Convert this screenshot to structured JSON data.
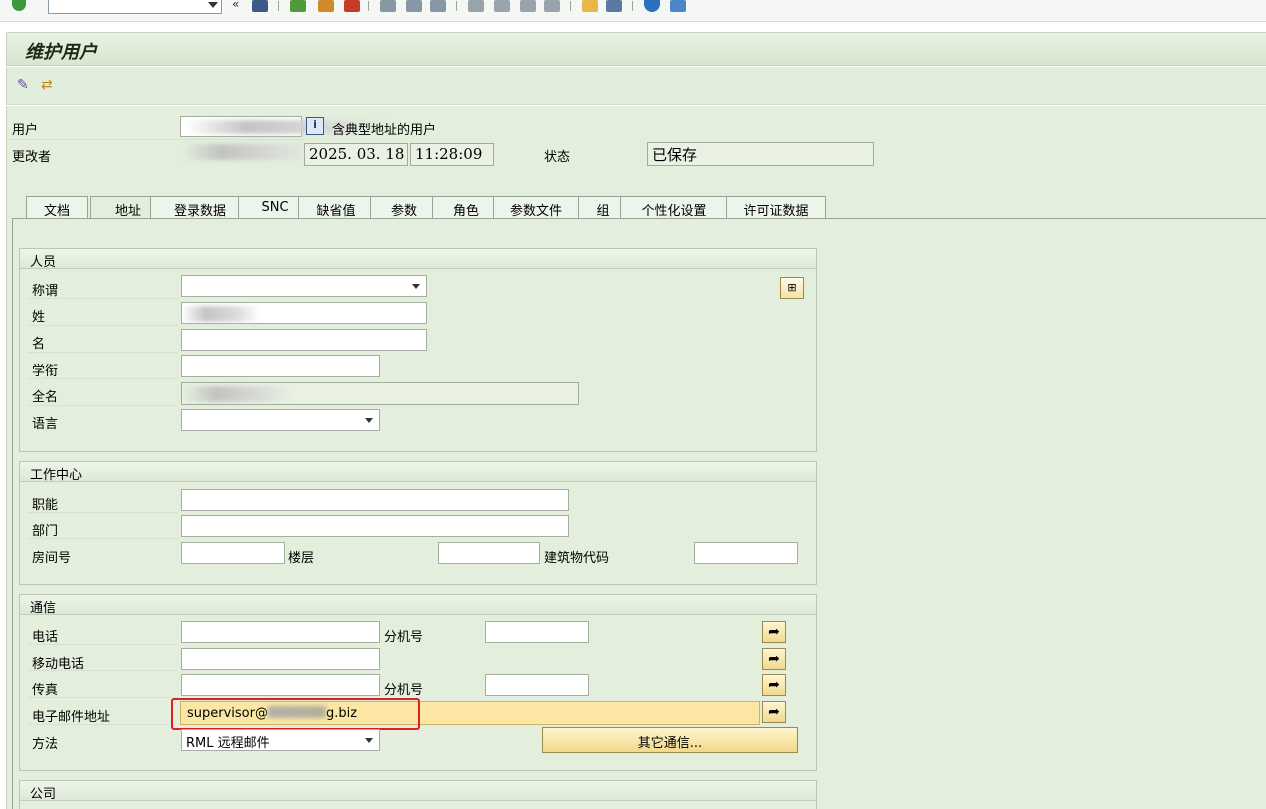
{
  "window": {
    "title": "维护用户"
  },
  "header": {
    "user_label": "用户",
    "user_hint": "含典型地址的用户",
    "changed_by_label": "更改者",
    "changed_date": "2025. 03. 18",
    "changed_time": "11:28:09",
    "status_label": "状态",
    "status_value": "已保存"
  },
  "tabs": [
    {
      "label": "文档"
    },
    {
      "label": "地址"
    },
    {
      "label": "登录数据"
    },
    {
      "label": "SNC"
    },
    {
      "label": "缺省值"
    },
    {
      "label": "参数"
    },
    {
      "label": "角色"
    },
    {
      "label": "参数文件"
    },
    {
      "label": "组"
    },
    {
      "label": "个性化设置"
    },
    {
      "label": "许可证数据"
    }
  ],
  "person": {
    "title": "人员",
    "salutation_label": "称谓",
    "last_name_label": "姓",
    "first_name_label": "名",
    "academic_title_label": "学衔",
    "full_name_label": "全名",
    "language_label": "语言"
  },
  "work_center": {
    "title": "工作中心",
    "function_label": "职能",
    "department_label": "部门",
    "room_label": "房间号",
    "floor_label": "楼层",
    "building_label": "建筑物代码"
  },
  "communication": {
    "title": "通信",
    "phone_label": "电话",
    "extension_label": "分机号",
    "mobile_label": "移动电话",
    "fax_label": "传真",
    "fax_extension_label": "分机号",
    "email_label": "电子邮件地址",
    "email_value_prefix": "supervisor@",
    "email_value_suffix": "g.biz",
    "method_label": "方法",
    "method_value": "RML 远程邮件",
    "other_comm_button": "其它通信..."
  },
  "company": {
    "title": "公司"
  }
}
